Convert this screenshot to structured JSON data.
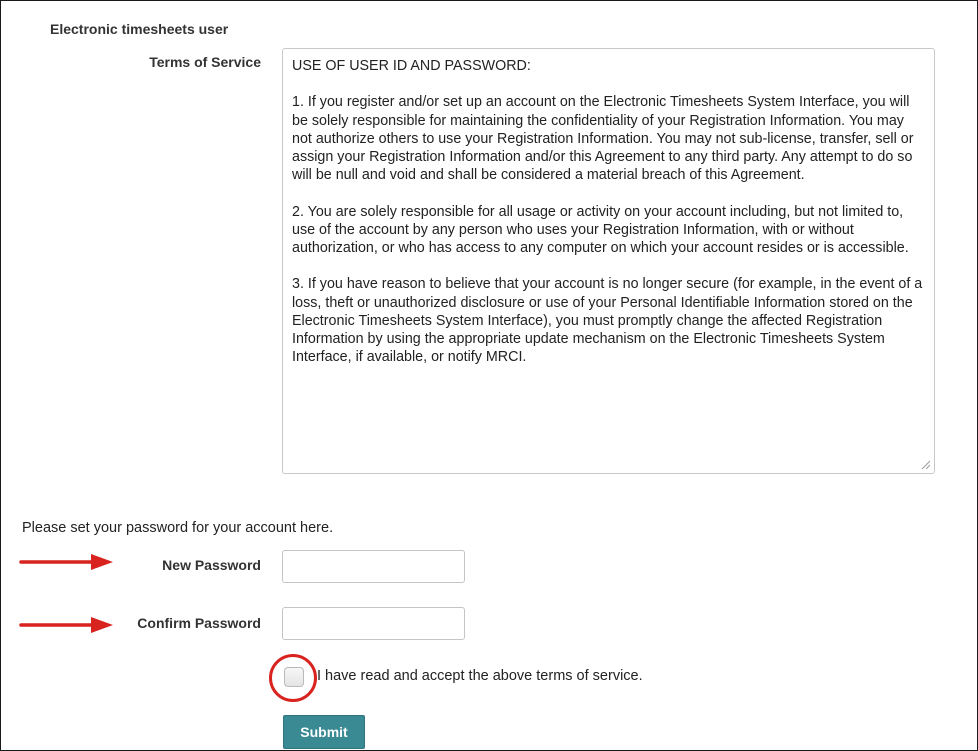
{
  "form": {
    "section_title": "Electronic timesheets user",
    "tos_label": "Terms of Service",
    "tos_paragraphs": [
      "USE OF USER ID AND PASSWORD:",
      "1. If you register and/or set up an account on the Electronic Timesheets System Interface, you will be solely responsible for maintaining the confidentiality of your Registration Information. You may not authorize others to use your Registration Information. You may not sub-license, transfer, sell or assign your Registration Information and/or this Agreement to any third party. Any attempt to do so will be null and void and shall be considered a material breach of this Agreement.",
      "2. You are solely responsible for all usage or activity on your account including, but not limited to, use of the account by any person who uses your Registration Information, with or without authorization, or who has access to any computer on which your account resides or is accessible.",
      "3. If you have reason to believe that your account is no longer secure (for example, in the event of a loss, theft or unauthorized disclosure or use of your Personal Identifiable Information stored on the Electronic Timesheets System Interface), you must promptly change the affected Registration Information by using the appropriate update mechanism on the Electronic Timesheets System Interface, if available, or notify MRCI."
    ],
    "instructions": "Please set your password for your account here.",
    "new_password_label": "New Password",
    "new_password_value": "",
    "confirm_password_label": "Confirm Password",
    "confirm_password_value": "",
    "accept_terms_label": "I have read and accept the above terms of service.",
    "accept_terms_checked": false,
    "submit_label": "Submit"
  },
  "annotations": {
    "arrow_color": "#d8231f",
    "circle_color": "#d8231f"
  },
  "theme": {
    "submit_color": "#3a8a94"
  }
}
